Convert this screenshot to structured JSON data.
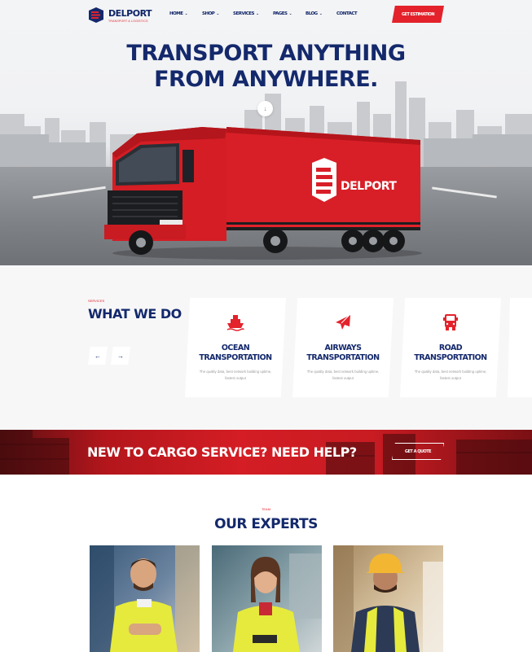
{
  "brand": {
    "name": "DELPORT",
    "tagline": "TRANSPORT & LOGISTICS",
    "primary": "#14296c",
    "accent": "#e3222b"
  },
  "nav": {
    "items": [
      {
        "label": "HOME",
        "dropdown": true
      },
      {
        "label": "SHOP",
        "dropdown": true
      },
      {
        "label": "SERVICES",
        "dropdown": true
      },
      {
        "label": "PAGES",
        "dropdown": true
      },
      {
        "label": "BLOG",
        "dropdown": true
      },
      {
        "label": "CONTACT",
        "dropdown": false
      }
    ],
    "chevron": "⌄",
    "cta": "GET ESTIMATION"
  },
  "hero": {
    "title_line1": "TRANSPORT ANYTHING",
    "title_line2": "FROM ANYWHERE.",
    "scroll_icon": "↓",
    "truck_brand": "DELPORT"
  },
  "services": {
    "eyebrow": "SERVICES",
    "title": "WHAT WE DO",
    "prev": "←",
    "next": "→",
    "cards": [
      {
        "icon": "ship-icon",
        "title_line1": "OCEAN",
        "title_line2": "TRANSPORTATION",
        "desc": "The quality data, best network building uptime, fastest output"
      },
      {
        "icon": "airplane-icon",
        "title_line1": "AIRWAYS",
        "title_line2": "TRANSPORTATION",
        "desc": "The quality data, best network building uptime, fastest output"
      },
      {
        "icon": "truck-icon",
        "title_line1": "ROAD",
        "title_line2": "TRANSPORTATION",
        "desc": "The quality data, best network building uptime, fastest output"
      }
    ]
  },
  "band": {
    "text": "NEW TO CARGO SERVICE? NEED HELP?",
    "button": "GET A QUOTE"
  },
  "team": {
    "eyebrow": "TEAM",
    "title": "OUR EXPERTS"
  }
}
